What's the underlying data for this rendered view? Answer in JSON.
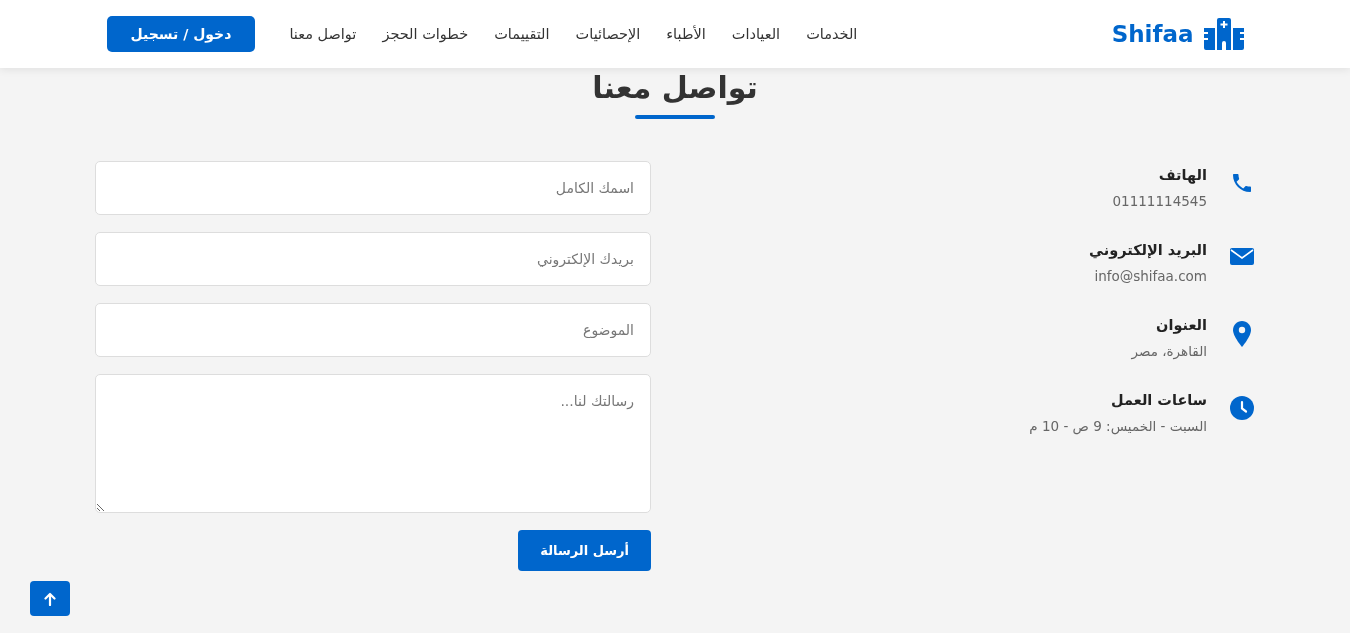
{
  "header": {
    "logo": "Shifaa",
    "nav": [
      "الخدمات",
      "العيادات",
      "الأطباء",
      "الإحصائيات",
      "التقييمات",
      "خطوات الحجز",
      "تواصل معنا"
    ],
    "login_button": "دخول / تسجيل"
  },
  "section_title": "تواصل معنا",
  "contact_items": [
    {
      "kind": "phone",
      "label": "الهاتف",
      "value": "01111114545"
    },
    {
      "kind": "email",
      "label": "البريد الإلكتروني",
      "value": "info@shifaa.com"
    },
    {
      "kind": "location",
      "label": "العنوان",
      "value": "القاهرة، مصر"
    },
    {
      "kind": "hours",
      "label": "ساعات العمل",
      "value": "السبت - الخميس: 9 ص - 10 م"
    }
  ],
  "form": {
    "fields": [
      {
        "kind": "input",
        "placeholder": "اسمك الكامل"
      },
      {
        "kind": "input",
        "placeholder": "بريدك الإلكتروني"
      },
      {
        "kind": "input",
        "placeholder": "الموضوع"
      },
      {
        "kind": "textarea",
        "placeholder": "رسالتك لنا..."
      }
    ],
    "submit": "أرسل الرسالة"
  }
}
